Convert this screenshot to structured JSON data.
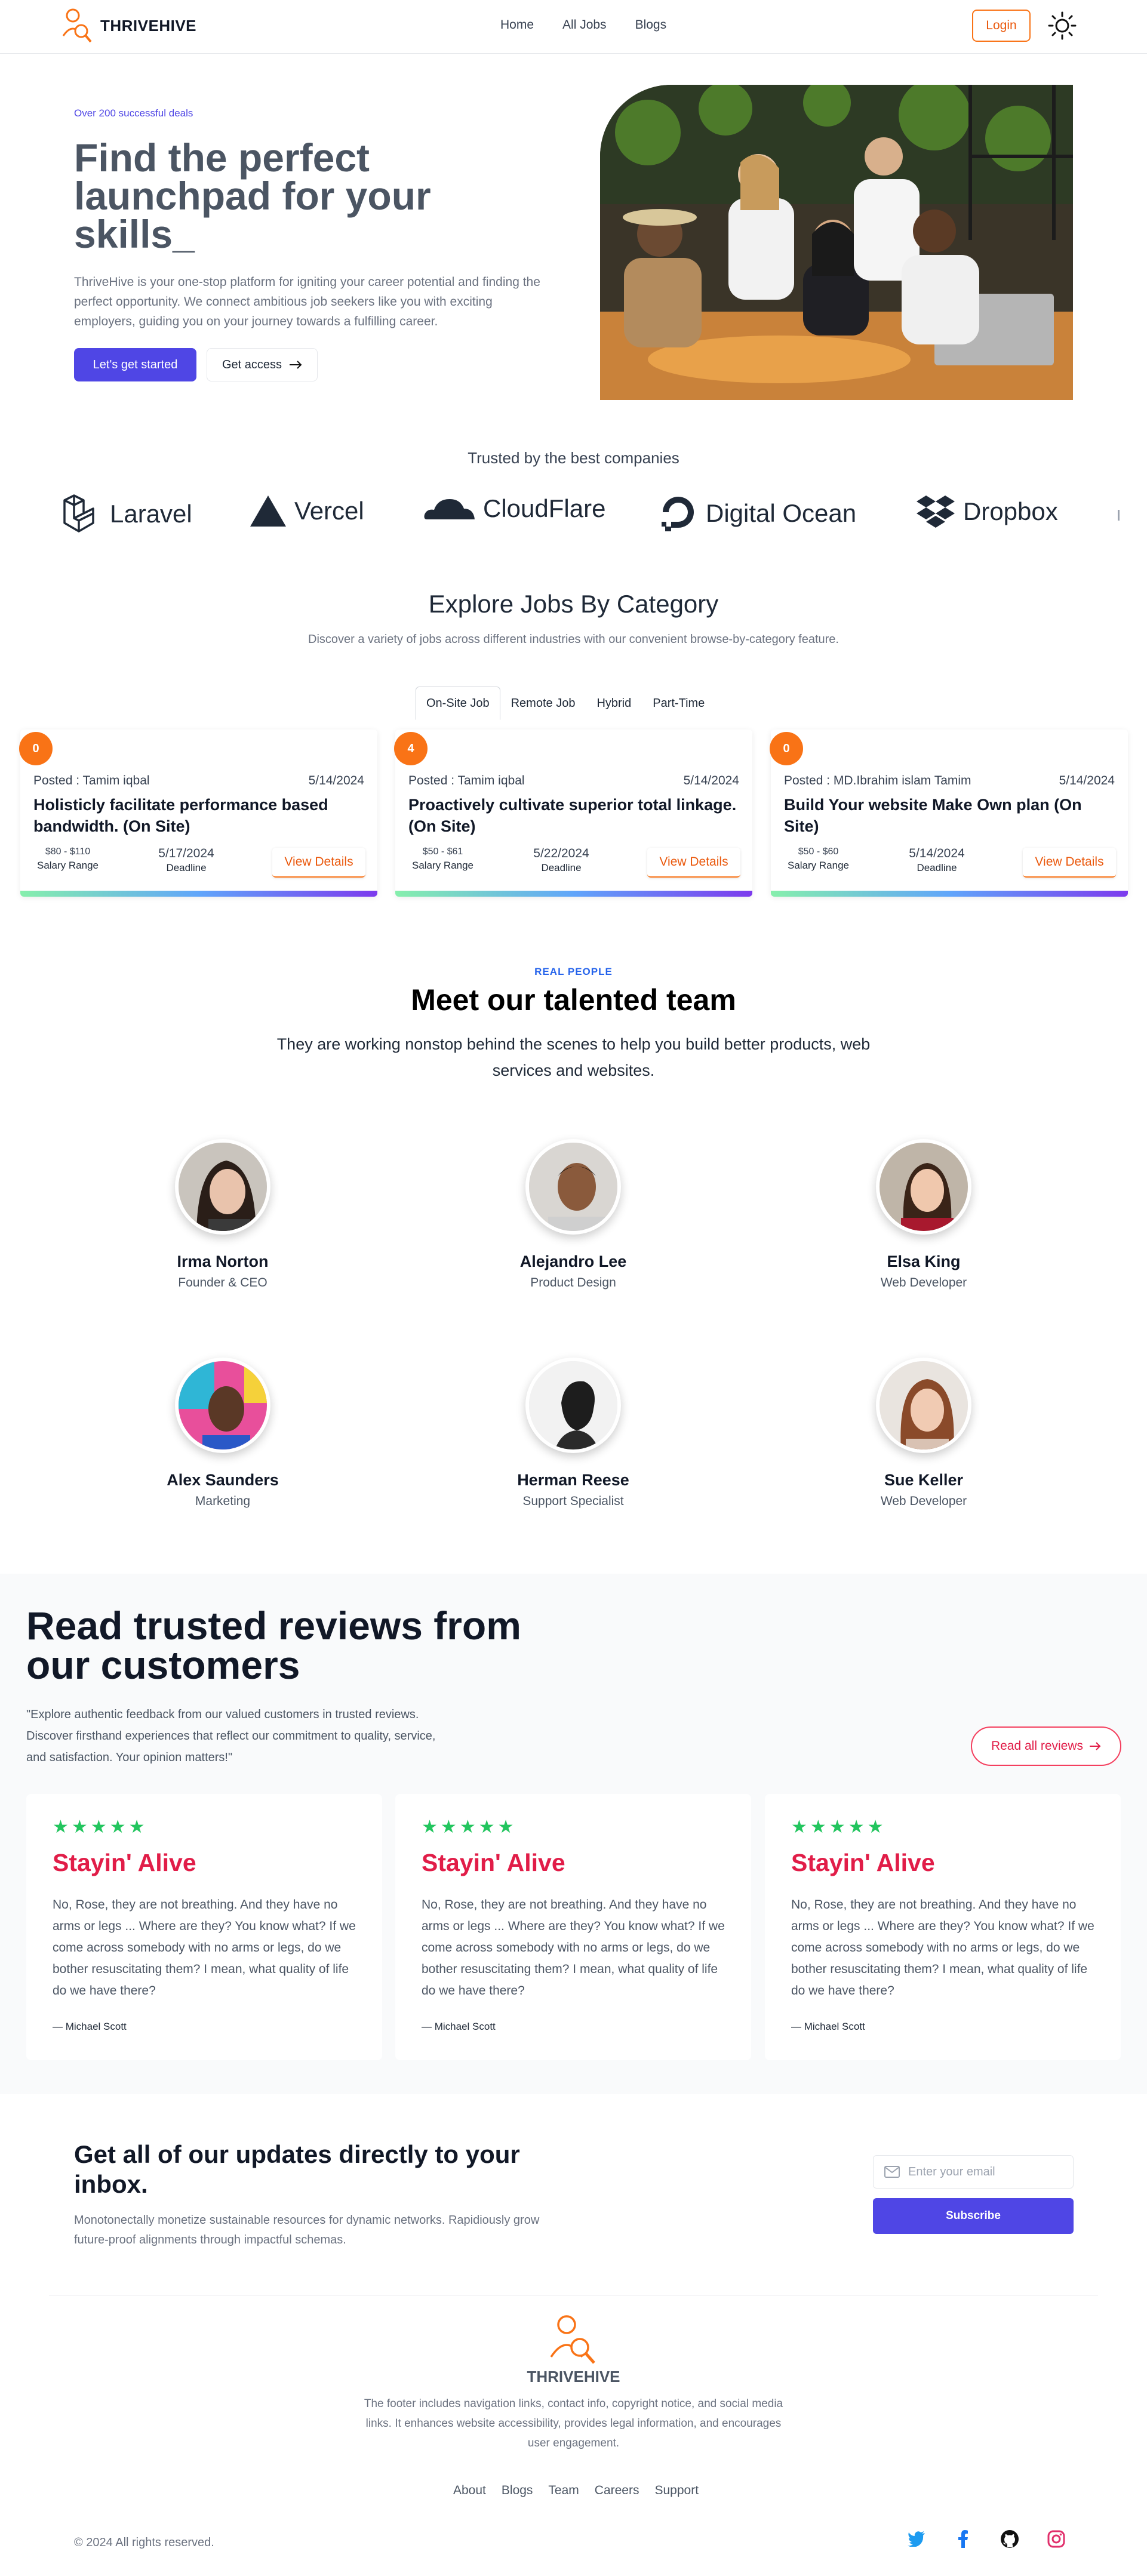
{
  "nav": {
    "brand": "THRIVEHIVE",
    "links": [
      "Home",
      "All Jobs",
      "Blogs"
    ],
    "login": "Login"
  },
  "hero": {
    "tag": "Over 200 successful deals",
    "title": "Find the perfect launchpad for your skills_",
    "description": "ThriveHive is your one-stop platform for igniting your career potential and finding the perfect opportunity. We connect ambitious job seekers like you with exciting employers, guiding you on your journey towards a fulfilling career.",
    "cta_primary": "Let's get started",
    "cta_secondary": "Get access"
  },
  "trusted": {
    "title": "Trusted by the best companies",
    "logos": [
      "Laravel",
      "Vercel",
      "CloudFlare",
      "Digital Ocean",
      "Dropbox"
    ]
  },
  "categories": {
    "title": "Explore Jobs By Category",
    "description": "Discover a variety of jobs across different industries with our convenient browse-by-category feature.",
    "tabs": [
      "On-Site Job",
      "Remote Job",
      "Hybrid",
      "Part-Time"
    ],
    "active_tab": "On-Site Job",
    "jobs": [
      {
        "badge": "0",
        "posted": "Posted : Tamim iqbal",
        "date": "5/14/2024",
        "title": "Holisticly facilitate performance based bandwidth. (On Site)",
        "salary": "$80 - $110",
        "salary_label": "Salary Range",
        "deadline": "5/17/2024",
        "deadline_label": "Deadline",
        "cta": "View Details"
      },
      {
        "badge": "4",
        "posted": "Posted : Tamim iqbal",
        "date": "5/14/2024",
        "title": "Proactively cultivate superior total linkage. (On Site)",
        "salary": "$50 - $61",
        "salary_label": "Salary Range",
        "deadline": "5/22/2024",
        "deadline_label": "Deadline",
        "cta": "View Details"
      },
      {
        "badge": "0",
        "posted": "Posted : MD.Ibrahim islam Tamim",
        "date": "5/14/2024",
        "title": "Build Your website Make Own plan (On Site)",
        "salary": "$50 - $60",
        "salary_label": "Salary Range",
        "deadline": "5/14/2024",
        "deadline_label": "Deadline",
        "cta": "View Details"
      }
    ]
  },
  "team": {
    "kicker": "REAL PEOPLE",
    "title": "Meet our talented team",
    "description": "They are working nonstop behind the scenes to help you build better products, web services and websites.",
    "members": [
      {
        "name": "Irma Norton",
        "role": "Founder & CEO"
      },
      {
        "name": "Alejandro Lee",
        "role": "Product Design"
      },
      {
        "name": "Elsa King",
        "role": "Web Developer"
      },
      {
        "name": "Alex Saunders",
        "role": "Marketing"
      },
      {
        "name": "Herman Reese",
        "role": "Support Specialist"
      },
      {
        "name": "Sue Keller",
        "role": "Web Developer"
      }
    ]
  },
  "reviews": {
    "title": "Read trusted reviews from our customers",
    "description": "\"Explore authentic feedback from our valued customers in trusted reviews. Discover firsthand experiences that reflect our commitment to quality, service, and satisfaction. Your opinion matters!\"",
    "cta": "Read all reviews",
    "items": [
      {
        "stars": 5,
        "title": "Stayin' Alive",
        "text": "No, Rose, they are not breathing. And they have no arms or legs ... Where are they? You know what? If we come across somebody with no arms or legs, do we bother resuscitating them? I mean, what quality of life do we have there?",
        "author": "— Michael Scott"
      },
      {
        "stars": 5,
        "title": "Stayin' Alive",
        "text": "No, Rose, they are not breathing. And they have no arms or legs ... Where are they? You know what? If we come across somebody with no arms or legs, do we bother resuscitating them? I mean, what quality of life do we have there?",
        "author": "— Michael Scott"
      },
      {
        "stars": 5,
        "title": "Stayin' Alive",
        "text": "No, Rose, they are not breathing. And they have no arms or legs ... Where are they? You know what? If we come across somebody with no arms or legs, do we bother resuscitating them? I mean, what quality of life do we have there?",
        "author": "— Michael Scott"
      }
    ]
  },
  "newsletter": {
    "title": "Get all of our updates directly to your inbox.",
    "description": "Monotonectally monetize sustainable resources for dynamic networks. Rapidiously grow future-proof alignments through impactful schemas.",
    "placeholder": "Enter your email",
    "cta": "Subscribe"
  },
  "footer": {
    "brand": "THRIVEHIVE",
    "description": "The footer includes navigation links, contact info, copyright notice, and social media links. It enhances website accessibility, provides legal information, and encourages user engagement.",
    "links": [
      "About",
      "Blogs",
      "Team",
      "Careers",
      "Support"
    ],
    "copyright": "© 2024 All rights reserved.",
    "socials": [
      "twitter-icon",
      "facebook-icon",
      "github-icon",
      "instagram-icon"
    ]
  },
  "colors": {
    "primary": "#4f46e5",
    "accent": "#f97316",
    "review_title": "#e11d48",
    "star": "#22c55e"
  }
}
